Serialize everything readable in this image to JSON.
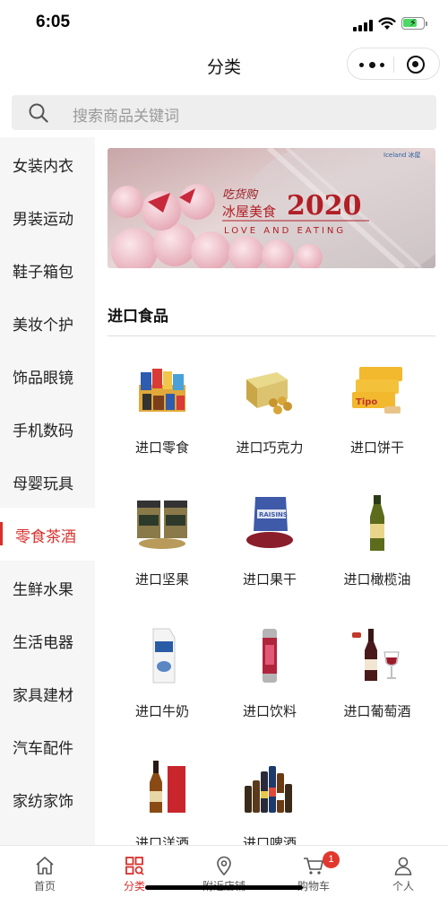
{
  "status_bar": {
    "time": "6:05"
  },
  "nav": {
    "title": "分类"
  },
  "search": {
    "placeholder": "搜索商品关键词"
  },
  "sidebar": {
    "items": [
      {
        "label": "女装内衣"
      },
      {
        "label": "男装运动"
      },
      {
        "label": "鞋子箱包"
      },
      {
        "label": "美妆个护"
      },
      {
        "label": "饰品眼镜"
      },
      {
        "label": "手机数码"
      },
      {
        "label": "母婴玩具"
      },
      {
        "label": "零食茶酒",
        "active": true
      },
      {
        "label": "生鲜水果"
      },
      {
        "label": "生活电器"
      },
      {
        "label": "家具建材"
      },
      {
        "label": "汽车配件"
      },
      {
        "label": "家纺家饰"
      }
    ]
  },
  "banner": {
    "brand": "Iceland 冰屋",
    "script_text": "吃货购",
    "title": "冰屋美食",
    "year": "2020",
    "slogan": "LOVE AND EATING"
  },
  "section": {
    "title": "进口食品",
    "products": [
      {
        "name": "进口零食",
        "icon": "snack-assortment-image"
      },
      {
        "name": "进口巧克力",
        "icon": "chocolate-box-image"
      },
      {
        "name": "进口饼干",
        "icon": "biscuit-packs-image"
      },
      {
        "name": "进口坚果",
        "icon": "nut-jars-image"
      },
      {
        "name": "进口果干",
        "icon": "raisin-bag-image"
      },
      {
        "name": "进口橄榄油",
        "icon": "olive-oil-bottle-image"
      },
      {
        "name": "进口牛奶",
        "icon": "milk-carton-image"
      },
      {
        "name": "进口饮料",
        "icon": "drink-can-image"
      },
      {
        "name": "进口葡萄酒",
        "icon": "red-wine-image"
      },
      {
        "name": "进口洋酒",
        "icon": "brandy-bottle-image"
      },
      {
        "name": "进口啤酒",
        "icon": "beer-bottles-image"
      }
    ]
  },
  "tab_bar": {
    "tabs": [
      {
        "label": "首页",
        "icon": "home-icon"
      },
      {
        "label": "分类",
        "icon": "category-icon",
        "active": true
      },
      {
        "label": "附近店铺",
        "icon": "location-pin-icon"
      },
      {
        "label": "购物车",
        "icon": "cart-icon",
        "badge": "1"
      },
      {
        "label": "个人",
        "icon": "user-icon"
      }
    ]
  },
  "colors": {
    "accent": "#d9302c",
    "badge": "#e0382e",
    "sidebar_bg": "#f6f6f6",
    "search_bg": "#eeeeee"
  }
}
